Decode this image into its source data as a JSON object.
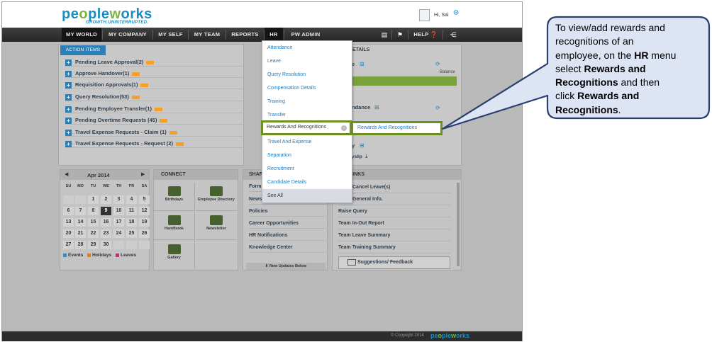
{
  "header": {
    "logo_main": "peopleworks",
    "logo_tagline": "GROWTH.UNINTERRUPTED.",
    "greeting": "Hi, Sai"
  },
  "nav": {
    "items": [
      {
        "label": "MY WORLD"
      },
      {
        "label": "MY COMPANY"
      },
      {
        "label": "MY SELF"
      },
      {
        "label": "MY TEAM"
      },
      {
        "label": "REPORTS"
      },
      {
        "label": "HR"
      },
      {
        "label": "PW ADMIN"
      }
    ],
    "help_label": "HELP"
  },
  "action_items": {
    "tab_label": "ACTION ITEMS",
    "rows": [
      {
        "label": "Pending Leave Approval(2)"
      },
      {
        "label": "Approve Handover(1)"
      },
      {
        "label": "Requisition Approvals(1)"
      },
      {
        "label": "Query Resolution(53)"
      },
      {
        "label": "Pending Employee Transfer(1)"
      },
      {
        "label": "Pending Overtime Requests (45)"
      },
      {
        "label": "Travel Expense Requests - Claim (1)"
      },
      {
        "label": "Travel Expense Requests - Request (2)"
      }
    ]
  },
  "details": {
    "title_fragment": "ETAILS",
    "leave_fragment": "e",
    "balance_label": "Balance",
    "attendance_fragment": "ndance",
    "payslip_fragment": "y",
    "payslip_sub": "yslip"
  },
  "hr_menu": {
    "items": [
      {
        "label": "Attendance"
      },
      {
        "label": "Leave"
      },
      {
        "label": "Query Resolution"
      },
      {
        "label": "Compensation Details"
      },
      {
        "label": "Training"
      },
      {
        "label": "Transfer"
      },
      {
        "label": "Rewards And Recognitions"
      },
      {
        "label": "Travel And Expense"
      },
      {
        "label": "Separation"
      },
      {
        "label": "Recruitment"
      },
      {
        "label": "Candidate Details"
      },
      {
        "label": "See All"
      }
    ]
  },
  "submenu": {
    "label": "Rewards And Recognitions"
  },
  "calendar": {
    "title": "Apr 2014",
    "dow": [
      "SU",
      "MO",
      "TU",
      "WE",
      "TH",
      "FR",
      "SA"
    ],
    "weeks": [
      [
        "",
        "",
        "1",
        "2",
        "3",
        "4",
        "5"
      ],
      [
        "6",
        "7",
        "8",
        "9",
        "10",
        "11",
        "12"
      ],
      [
        "13",
        "14",
        "15",
        "16",
        "17",
        "18",
        "19"
      ],
      [
        "20",
        "21",
        "22",
        "23",
        "24",
        "25",
        "26"
      ],
      [
        "27",
        "28",
        "29",
        "30",
        "",
        "",
        ""
      ]
    ],
    "today": "9",
    "legend": [
      {
        "label": "Events",
        "color": "#2d8fd0"
      },
      {
        "label": "Holidays",
        "color": "#e07b20"
      },
      {
        "label": "Leaves",
        "color": "#c2307a"
      }
    ]
  },
  "connect": {
    "title": "CONNECT",
    "cells": [
      {
        "label": "Birthdays"
      },
      {
        "label": "Employee Directory"
      },
      {
        "label": "Handbook"
      },
      {
        "label": "Newsletter"
      },
      {
        "label": "Gallery"
      }
    ]
  },
  "share": {
    "title_fragment": "SHAR",
    "items": [
      {
        "label": "Forms"
      },
      {
        "label": "News"
      },
      {
        "label": "Policies"
      },
      {
        "label": "Career Opportunities"
      },
      {
        "label": "HR Notifications"
      },
      {
        "label": "Knowledge Center"
      }
    ],
    "footer_label": "New Updates Below"
  },
  "quick_links": {
    "title_fragment": "LINKS",
    "items": [
      {
        "label": "Cancel Leave(s)"
      },
      {
        "label": "General Info."
      },
      {
        "label": "Raise Query"
      },
      {
        "label": "Team In-Out Report"
      },
      {
        "label": "Team Leave Summary"
      },
      {
        "label": "Team Training Summary"
      }
    ],
    "suggest_label": "Suggestions/ Feedback"
  },
  "footer": {
    "copyright": "© Copyright 2014",
    "logo": "peopleworks"
  },
  "callout": {
    "line1": "To view/add rewards and",
    "line2": "recognitions of an",
    "line3a": "employee, on the ",
    "line3b": "HR",
    "line3c": " menu",
    "line4a": "select ",
    "line4b": "Rewards and",
    "line5a": "Recognitions",
    "line5b": " and then",
    "line6a": "click ",
    "line6b": "Rewards and",
    "line7a": "Recognitions",
    "line7b": "."
  },
  "colors": {
    "nav_bg": "#2b2b2b",
    "accent_blue": "#2d7eb5",
    "highlight_green": "#6c8f1e",
    "callout_fill": "#dde5f5",
    "callout_stroke": "#2a3f6e"
  }
}
